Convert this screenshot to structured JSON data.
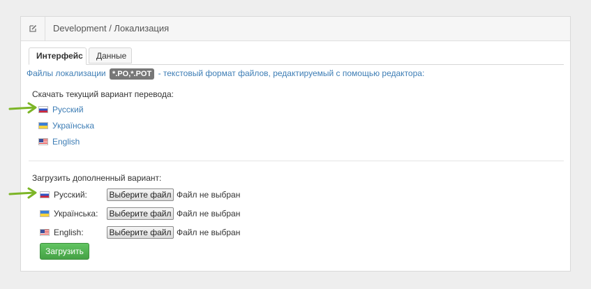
{
  "header": {
    "icon": "edit-icon",
    "title": "Development / Локализация"
  },
  "tabs": [
    {
      "label": "Интерфейс",
      "active": true
    },
    {
      "label": "Данные",
      "active": false
    }
  ],
  "info": {
    "prefix": "Файлы локализации",
    "badge": "*.PO,*.POT",
    "suffix": "- текстовый формат файлов, редактируемый с помощью редактора:"
  },
  "download": {
    "label": "Скачать текущий вариант перевода:",
    "items": [
      {
        "flag": "ru-flag-icon",
        "label": "Русский"
      },
      {
        "flag": "ua-flag-icon",
        "label": "Українська"
      },
      {
        "flag": "us-flag-icon",
        "label": "English"
      }
    ]
  },
  "upload": {
    "label": "Загрузить дополненный вариант:",
    "rows": [
      {
        "flag": "ru-flag-icon",
        "label": "Русский:",
        "button": "Выберите файл",
        "status": "Файл не выбран"
      },
      {
        "flag": "ua-flag-icon",
        "label": "Українська:",
        "button": "Выберите файл",
        "status": "Файл не выбран"
      },
      {
        "flag": "us-flag-icon",
        "label": "English:",
        "button": "Выберите файл",
        "status": "Файл не выбран"
      }
    ],
    "submit": "Загрузить"
  },
  "colors": {
    "link": "#3d7db5",
    "submit": "#4cae4c",
    "arrow": "#7cb527"
  }
}
